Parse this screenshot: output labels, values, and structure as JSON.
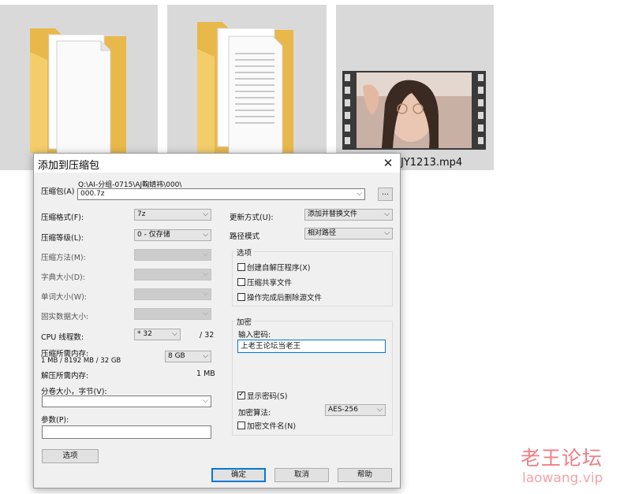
{
  "explorer": {
    "video_filename": "JY1213.mp4"
  },
  "dialog": {
    "title": "添加到压缩包",
    "archive_label": "压缩包(A)",
    "archive_path": "Q:\\AI-分组-0715\\AJ鞠婧祎\\000\\",
    "archive_name": "000.7z",
    "browse_label": "...",
    "format_label": "压缩格式(F):",
    "format_value": "7z",
    "level_label": "压缩等级(L):",
    "level_value": "0 - 仅存储",
    "method_label": "压缩方法(M):",
    "dict_label": "字典大小(D):",
    "word_label": "单词大小(W):",
    "solid_label": "固实数据大小:",
    "threads_label": "CPU 线程数:",
    "threads_value": "* 32",
    "threads_max": "/ 32",
    "mem_comp_label": "压缩所需内存:",
    "mem_comp_detail": "1 MB / 8192 MB / 32 GB",
    "mem_comp_value": "8 GB",
    "mem_decomp_label": "解压所需内存:",
    "mem_decomp_value": "1 MB",
    "split_label": "分卷大小，字节(V):",
    "split_value": "",
    "params_label": "参数(P):",
    "params_value": "",
    "options_button": "选项",
    "update_label": "更新方式(U):",
    "update_value": "添加并替换文件",
    "path_label": "路径模式",
    "path_value": "相对路径",
    "options_group": "选项",
    "opt_sfx": "创建自解压程序(X)",
    "opt_shared": "压缩共享文件",
    "opt_delete": "操作完成后删除源文件",
    "encrypt_group": "加密",
    "password_label": "输入密码:",
    "password_value": "上老王论坛当老王",
    "show_password": "显示密码(S)",
    "enc_method_label": "加密算法:",
    "enc_method_value": "AES-256",
    "encrypt_names": "加密文件名(N)",
    "ok_button": "确定",
    "cancel_button": "取消",
    "help_button": "帮助"
  },
  "watermark": {
    "line1": "老王论坛",
    "line2": "laowang.vip"
  },
  "colors": {
    "tile_bg": "#d9d9d9",
    "dialog_bg": "#f0f0f0",
    "accent": "#0078d7",
    "watermark": "#f07e86"
  }
}
